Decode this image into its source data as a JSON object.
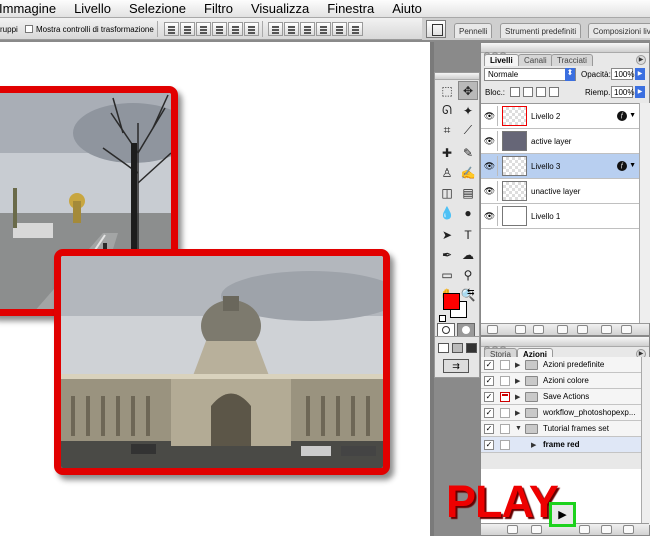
{
  "menubar": {
    "items": [
      "Immagine",
      "Livello",
      "Selezione",
      "Filtro",
      "Visualizza",
      "Finestra",
      "Aiuto"
    ]
  },
  "options_bar": {
    "group_label": "ruppi",
    "transform_label": "Mostra controlli di trasformazione"
  },
  "palette_well": {
    "tabs": [
      "Pennelli",
      "Strumenti predefiniti",
      "Composizioni liv"
    ]
  },
  "layers_palette": {
    "tabs": [
      "Livelli",
      "Canali",
      "Tracciati"
    ],
    "blend_mode": "Normale",
    "opacity_label": "Opacità:",
    "opacity_value": "100%",
    "lock_label": "Bloc.:",
    "fill_label": "Riemp.:",
    "fill_value": "100%",
    "layers": [
      {
        "name": "Livello 2",
        "has_fx": true,
        "selected": false
      },
      {
        "name": "active layer",
        "has_fx": false,
        "selected": false
      },
      {
        "name": "Livello 3",
        "has_fx": true,
        "selected": true
      },
      {
        "name": "unactive layer",
        "has_fx": false,
        "selected": false
      },
      {
        "name": "Livello 1",
        "has_fx": false,
        "selected": false
      }
    ]
  },
  "actions_palette": {
    "tabs": [
      "Storia",
      "Azioni"
    ],
    "items": [
      {
        "name": "Azioni predefinite",
        "type": "set",
        "expanded": false
      },
      {
        "name": "Azioni colore",
        "type": "set",
        "expanded": false
      },
      {
        "name": "Save Actions",
        "type": "set",
        "expanded": false
      },
      {
        "name": "workflow_photoshopexp...",
        "type": "set",
        "expanded": false
      },
      {
        "name": "Tutorial frames set",
        "type": "set",
        "expanded": true
      },
      {
        "name": "frame red",
        "type": "action",
        "expanded": false
      }
    ]
  },
  "annotation": {
    "text": "PLAY",
    "color": "#ee0000"
  },
  "colors": {
    "foreground": "#ff0000",
    "background": "#ffffff",
    "frame": "#e10000",
    "highlight_box": "#1dd21d"
  }
}
